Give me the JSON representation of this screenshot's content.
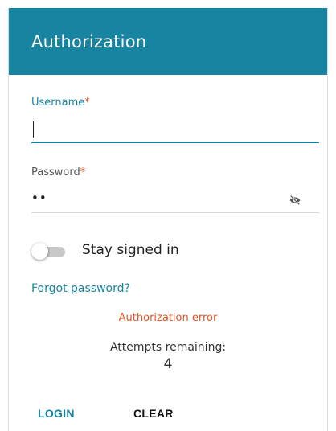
{
  "dialog": {
    "title": "Authorization"
  },
  "form": {
    "username": {
      "label": "Username",
      "required_marker": "*",
      "value": ""
    },
    "password": {
      "label": "Password",
      "required_marker": "*",
      "masked_value": "••",
      "visibility_icon": "eye-slash-icon"
    },
    "stay_signed_in": {
      "label": "Stay signed in",
      "checked": false
    },
    "forgot_password_label": "Forgot password?"
  },
  "status": {
    "error_message": "Authorization error",
    "attempts_label": "Attempts remaining:",
    "attempts_count": "4"
  },
  "actions": {
    "login_label": "LOGIN",
    "clear_label": "CLEAR"
  },
  "colors": {
    "accent": "#1785a2",
    "error": "#e05323",
    "toggle_track_off": "#c7c7c7"
  }
}
